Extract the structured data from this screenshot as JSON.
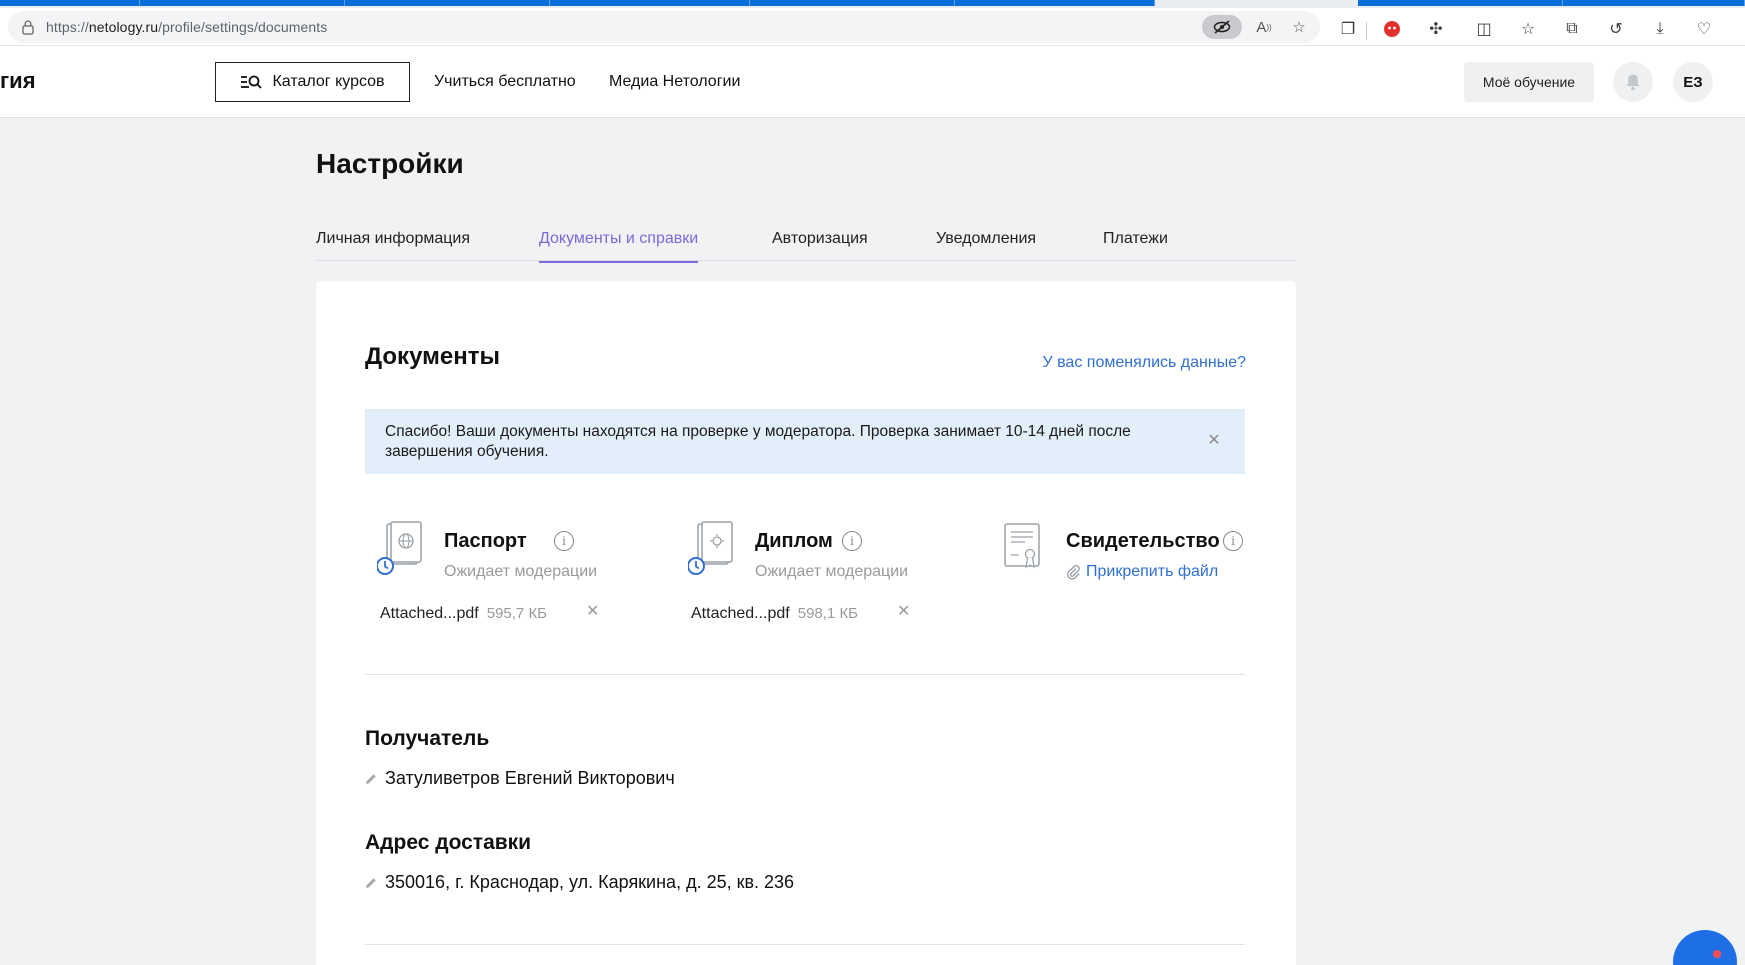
{
  "browser": {
    "url_prefix": "https://",
    "url_domain": "netology.ru",
    "url_path": "/profile/settings/documents"
  },
  "header": {
    "logo_fragment": "гия",
    "catalog_label": "Каталог курсов",
    "nav": [
      "Учиться бесплатно",
      "Медиа Нетологии"
    ],
    "my_learning": "Моё обучение",
    "avatar_initials": "ЕЗ"
  },
  "page": {
    "title": "Настройки",
    "tabs": [
      "Личная информация",
      "Документы и справки",
      "Авторизация",
      "Уведомления",
      "Платежи"
    ],
    "active_tab": "Документы и справки"
  },
  "documents": {
    "title": "Документы",
    "changed_link": "У вас поменялись данные?",
    "notice": "Спасибо! Ваши документы находятся на проверке у модератора. Проверка занимает 10-14 дней после завершения обучения.",
    "items": [
      {
        "name": "Паспорт",
        "status": "Ожидает модерации",
        "file_name": "Attached...pdf",
        "file_size": "595,7 КБ"
      },
      {
        "name": "Диплом",
        "status": "Ожидает модерации",
        "file_name": "Attached...pdf",
        "file_size": "598,1 КБ"
      },
      {
        "name": "Свидетельство",
        "attach_label": "Прикрепить файл"
      }
    ]
  },
  "recipient": {
    "title": "Получатель",
    "value": "Затуливетров Евгений Викторович"
  },
  "delivery": {
    "title": "Адрес доставки",
    "value": "350016, г. Краснодар, ул. Карякина, д. 25, кв. 236"
  },
  "colors": {
    "accent_purple": "#7b6ad8",
    "link_blue": "#2f6fd0",
    "notice_bg": "#e3eefb",
    "page_bg": "#f1f2f4",
    "chat_blue": "#1e6fe6"
  }
}
